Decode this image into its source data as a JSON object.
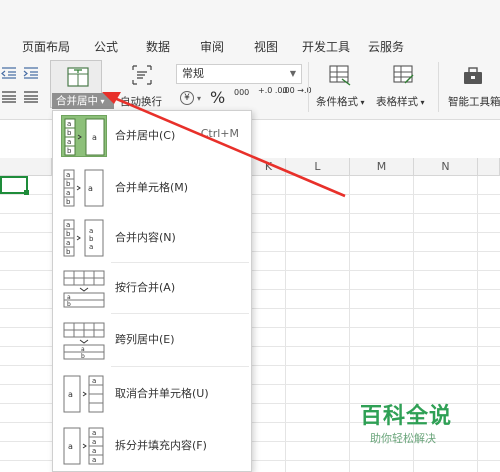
{
  "menu_tabs": [
    "页面布局",
    "公式",
    "数据",
    "审阅",
    "视图",
    "开发工具",
    "云服务"
  ],
  "ribbon": {
    "merge_label": "合并居中",
    "wrap_label": "自动换行",
    "number_format": "常规",
    "currency_symbol": "¥",
    "percent_symbol": "%",
    "thousands_symbol": "000",
    "dec_increase": "+.0 .00",
    "dec_decrease": ".00 →.0",
    "conditional_format": "条件格式",
    "table_style": "表格样式",
    "smart_toolbox": "智能工具箱"
  },
  "columns": [
    "K",
    "L",
    "M",
    "N"
  ],
  "merge_menu": {
    "items": [
      {
        "label": "合并居中(C)",
        "shortcut": "Ctrl+M",
        "highlighted": true
      },
      {
        "label": "合并单元格(M)",
        "shortcut": "",
        "highlighted": false
      },
      {
        "label": "合并内容(N)",
        "shortcut": "",
        "highlighted": false
      },
      {
        "label": "按行合并(A)",
        "shortcut": "",
        "highlighted": false
      },
      {
        "label": "跨列居中(E)",
        "shortcut": "",
        "highlighted": false
      },
      {
        "label": "取消合并单元格(U)",
        "shortcut": "",
        "highlighted": false
      },
      {
        "label": "拆分并填充内容(F)",
        "shortcut": "",
        "highlighted": false
      }
    ]
  },
  "watermark": {
    "title": "百科全说",
    "subtitle": "助你轻松解决"
  },
  "colors": {
    "accent_green": "#1e8c3a",
    "highlight_green": "#8dc07a",
    "arrow_red": "#e8302a",
    "watermark_green": "#2fa055"
  }
}
